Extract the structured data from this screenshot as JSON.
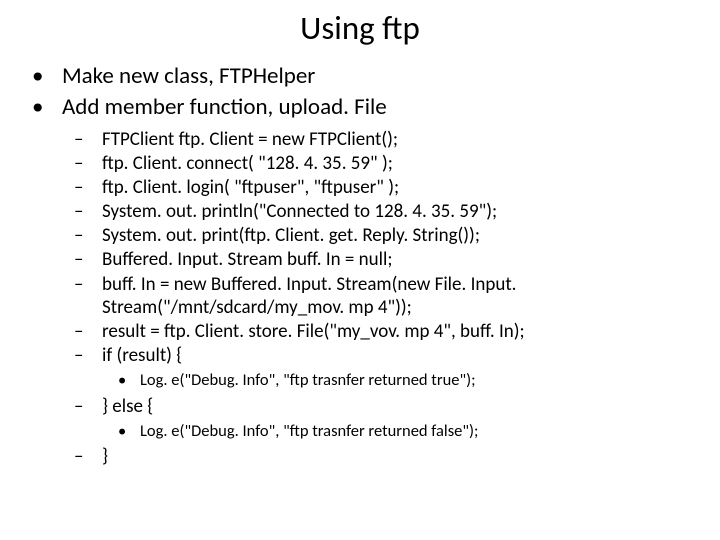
{
  "title": "Using ftp",
  "level1": [
    "Make new class, FTPHelper",
    "Add member function, upload. File"
  ],
  "level2": [
    "FTPClient ftp. Client = new FTPClient();",
    "ftp. Client. connect( \"128. 4. 35. 59\" );",
    "ftp. Client. login( \"ftpuser\", \"ftpuser\" );",
    "System. out. println(\"Connected to 128. 4. 35. 59\");",
    "System. out. print(ftp. Client. get. Reply. String());",
    "Buffered. Input. Stream buff. In = null;",
    "buff. In = new Buffered. Input. Stream(new File. Input. Stream(\"/mnt/sdcard/my_mov. mp 4\"));",
    "result = ftp. Client. store. File(\"my_vov. mp 4\", buff. In);",
    "if (result) {",
    "} else {",
    "}"
  ],
  "level3": [
    "Log. e(\"Debug. Info\", \"ftp trasnfer returned true\");",
    "Log. e(\"Debug. Info\", \"ftp trasnfer returned false\");"
  ]
}
